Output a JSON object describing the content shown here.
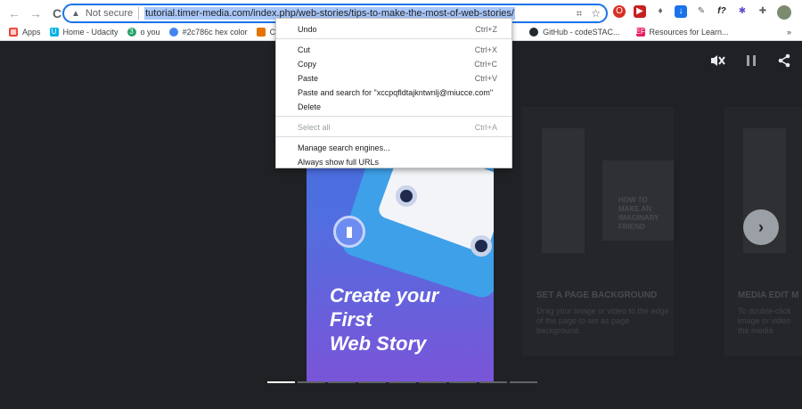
{
  "browser": {
    "back_icon": "←",
    "forward_icon": "→",
    "reload_icon": "C",
    "security_text": "Not secure",
    "url": "tutorial.timer-media.com/index.php/web-stories/tips-to-make-the-most-of-web-stories/"
  },
  "bookmarks": [
    {
      "label": "Apps",
      "icon": "apps-grid-icon",
      "color": "#ea4335"
    },
    {
      "label": "Home - Udacity",
      "icon": "udacity-icon",
      "color": "#02b3e4"
    },
    {
      "label": "o you",
      "icon": "green-dot-icon",
      "color": "#21a366"
    },
    {
      "label": "#2c786c hex color",
      "icon": "color-wheel-icon",
      "color": "#4285f4"
    },
    {
      "label": "Color",
      "icon": "palette-icon",
      "color": "#e37400"
    },
    {
      "label": "GitHub - codeSTAC...",
      "icon": "github-icon",
      "color": "#24292f"
    },
    {
      "label": "Resources for Learn...",
      "icon": "ef-icon",
      "color": "#e91e63"
    }
  ],
  "bookmarks_more": "»",
  "context_menu": {
    "items": [
      {
        "label": "Undo",
        "shortcut": "Ctrl+Z",
        "disabled": false
      },
      {
        "label": "Cut",
        "shortcut": "Ctrl+X",
        "disabled": false
      },
      {
        "label": "Copy",
        "shortcut": "Ctrl+C",
        "disabled": false
      },
      {
        "label": "Paste",
        "shortcut": "Ctrl+V",
        "disabled": false
      },
      {
        "label": "Paste and search for \"xccpqfldtajkntwnlj@miucce.com\"",
        "shortcut": "",
        "disabled": false
      },
      {
        "label": "Delete",
        "shortcut": "",
        "disabled": false
      },
      {
        "label": "Select all",
        "shortcut": "Ctrl+A",
        "disabled": true
      },
      {
        "label": "Manage search engines...",
        "shortcut": "",
        "disabled": false
      },
      {
        "label": "Always show full URLs",
        "shortcut": "",
        "disabled": false
      }
    ]
  },
  "story": {
    "title": "Create your\nFirst\nWeb Story"
  },
  "side_left": {
    "thumb_text": "HOW TO MAKE AN IMAGINARY FRIEND",
    "heading": "SET A PAGE BACKGROUND",
    "body": "Drag your image or video to the edge of the page to set as page background."
  },
  "side_right": {
    "heading": "MEDIA EDIT M",
    "body": "To double-click image or video the media"
  },
  "story_controls": {
    "mute_icon": "muted-speaker-icon",
    "pause_icon": "pause-icon",
    "share_icon": "share-icon"
  },
  "next_icon": "›",
  "progress": {
    "segments": 9,
    "active": 0
  }
}
